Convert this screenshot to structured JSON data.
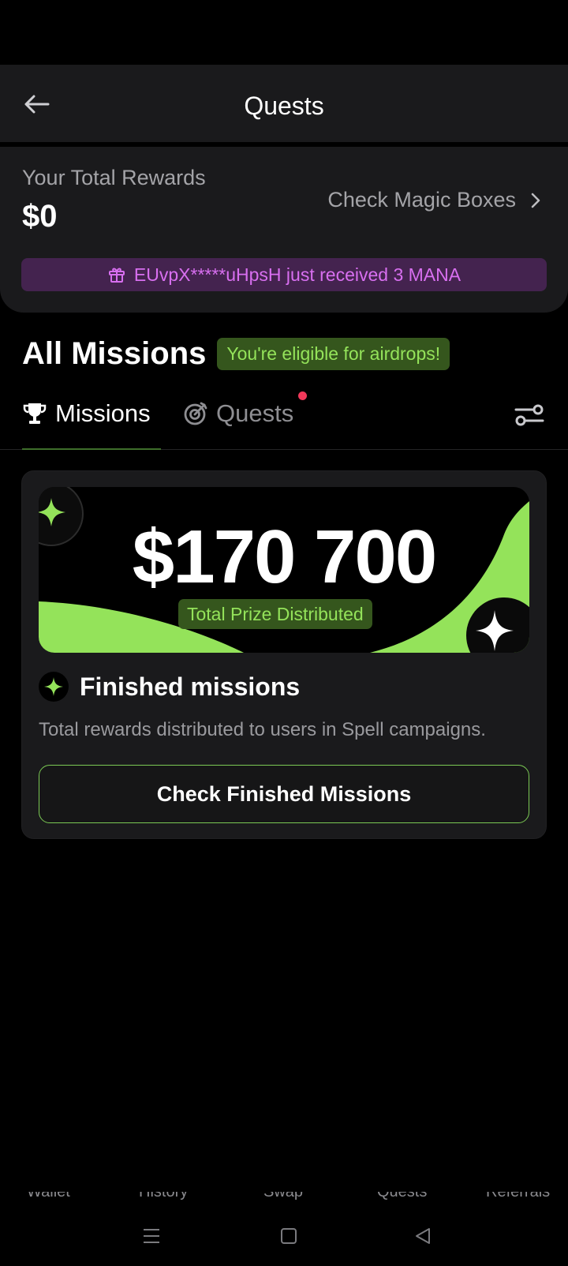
{
  "header": {
    "title": "Quests"
  },
  "rewards": {
    "label": "Your Total Rewards",
    "value": "$0",
    "magic_boxes_link": "Check Magic Boxes",
    "ticker_text": "EUvpX*****uHpsH just received 3 MANA"
  },
  "missions_section": {
    "title": "All Missions",
    "eligible_badge": "You're eligible for airdrops!"
  },
  "tabs": [
    {
      "label": "Missions",
      "icon": "trophy-icon",
      "active": true
    },
    {
      "label": "Quests",
      "icon": "target-icon",
      "active": false,
      "has_notification": true
    }
  ],
  "finished_card": {
    "prize_amount": "$170 700",
    "prize_label": "Total Prize Distributed",
    "title": "Finished missions",
    "description": "Total rewards distributed to users in Spell campaigns.",
    "button_label": "Check Finished Missions"
  },
  "bottom_nav": [
    "Wallet",
    "History",
    "Swap",
    "Quests",
    "Referrals"
  ],
  "colors": {
    "accent_green": "#94e35a",
    "badge_green_bg": "#35561d",
    "ticker_purple": "#d86ff0",
    "notification_red": "#f0395a"
  }
}
